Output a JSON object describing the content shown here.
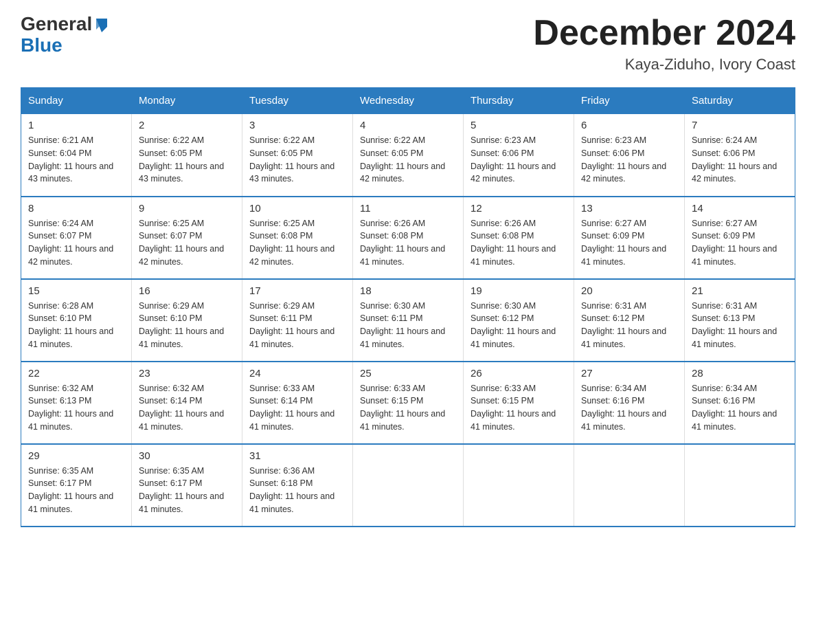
{
  "logo": {
    "general": "General",
    "blue": "Blue"
  },
  "title": "December 2024",
  "location": "Kaya-Ziduho, Ivory Coast",
  "days_of_week": [
    "Sunday",
    "Monday",
    "Tuesday",
    "Wednesday",
    "Thursday",
    "Friday",
    "Saturday"
  ],
  "weeks": [
    [
      {
        "day": "1",
        "sunrise": "6:21 AM",
        "sunset": "6:04 PM",
        "daylight": "11 hours and 43 minutes."
      },
      {
        "day": "2",
        "sunrise": "6:22 AM",
        "sunset": "6:05 PM",
        "daylight": "11 hours and 43 minutes."
      },
      {
        "day": "3",
        "sunrise": "6:22 AM",
        "sunset": "6:05 PM",
        "daylight": "11 hours and 43 minutes."
      },
      {
        "day": "4",
        "sunrise": "6:22 AM",
        "sunset": "6:05 PM",
        "daylight": "11 hours and 42 minutes."
      },
      {
        "day": "5",
        "sunrise": "6:23 AM",
        "sunset": "6:06 PM",
        "daylight": "11 hours and 42 minutes."
      },
      {
        "day": "6",
        "sunrise": "6:23 AM",
        "sunset": "6:06 PM",
        "daylight": "11 hours and 42 minutes."
      },
      {
        "day": "7",
        "sunrise": "6:24 AM",
        "sunset": "6:06 PM",
        "daylight": "11 hours and 42 minutes."
      }
    ],
    [
      {
        "day": "8",
        "sunrise": "6:24 AM",
        "sunset": "6:07 PM",
        "daylight": "11 hours and 42 minutes."
      },
      {
        "day": "9",
        "sunrise": "6:25 AM",
        "sunset": "6:07 PM",
        "daylight": "11 hours and 42 minutes."
      },
      {
        "day": "10",
        "sunrise": "6:25 AM",
        "sunset": "6:08 PM",
        "daylight": "11 hours and 42 minutes."
      },
      {
        "day": "11",
        "sunrise": "6:26 AM",
        "sunset": "6:08 PM",
        "daylight": "11 hours and 41 minutes."
      },
      {
        "day": "12",
        "sunrise": "6:26 AM",
        "sunset": "6:08 PM",
        "daylight": "11 hours and 41 minutes."
      },
      {
        "day": "13",
        "sunrise": "6:27 AM",
        "sunset": "6:09 PM",
        "daylight": "11 hours and 41 minutes."
      },
      {
        "day": "14",
        "sunrise": "6:27 AM",
        "sunset": "6:09 PM",
        "daylight": "11 hours and 41 minutes."
      }
    ],
    [
      {
        "day": "15",
        "sunrise": "6:28 AM",
        "sunset": "6:10 PM",
        "daylight": "11 hours and 41 minutes."
      },
      {
        "day": "16",
        "sunrise": "6:29 AM",
        "sunset": "6:10 PM",
        "daylight": "11 hours and 41 minutes."
      },
      {
        "day": "17",
        "sunrise": "6:29 AM",
        "sunset": "6:11 PM",
        "daylight": "11 hours and 41 minutes."
      },
      {
        "day": "18",
        "sunrise": "6:30 AM",
        "sunset": "6:11 PM",
        "daylight": "11 hours and 41 minutes."
      },
      {
        "day": "19",
        "sunrise": "6:30 AM",
        "sunset": "6:12 PM",
        "daylight": "11 hours and 41 minutes."
      },
      {
        "day": "20",
        "sunrise": "6:31 AM",
        "sunset": "6:12 PM",
        "daylight": "11 hours and 41 minutes."
      },
      {
        "day": "21",
        "sunrise": "6:31 AM",
        "sunset": "6:13 PM",
        "daylight": "11 hours and 41 minutes."
      }
    ],
    [
      {
        "day": "22",
        "sunrise": "6:32 AM",
        "sunset": "6:13 PM",
        "daylight": "11 hours and 41 minutes."
      },
      {
        "day": "23",
        "sunrise": "6:32 AM",
        "sunset": "6:14 PM",
        "daylight": "11 hours and 41 minutes."
      },
      {
        "day": "24",
        "sunrise": "6:33 AM",
        "sunset": "6:14 PM",
        "daylight": "11 hours and 41 minutes."
      },
      {
        "day": "25",
        "sunrise": "6:33 AM",
        "sunset": "6:15 PM",
        "daylight": "11 hours and 41 minutes."
      },
      {
        "day": "26",
        "sunrise": "6:33 AM",
        "sunset": "6:15 PM",
        "daylight": "11 hours and 41 minutes."
      },
      {
        "day": "27",
        "sunrise": "6:34 AM",
        "sunset": "6:16 PM",
        "daylight": "11 hours and 41 minutes."
      },
      {
        "day": "28",
        "sunrise": "6:34 AM",
        "sunset": "6:16 PM",
        "daylight": "11 hours and 41 minutes."
      }
    ],
    [
      {
        "day": "29",
        "sunrise": "6:35 AM",
        "sunset": "6:17 PM",
        "daylight": "11 hours and 41 minutes."
      },
      {
        "day": "30",
        "sunrise": "6:35 AM",
        "sunset": "6:17 PM",
        "daylight": "11 hours and 41 minutes."
      },
      {
        "day": "31",
        "sunrise": "6:36 AM",
        "sunset": "6:18 PM",
        "daylight": "11 hours and 41 minutes."
      },
      null,
      null,
      null,
      null
    ]
  ]
}
